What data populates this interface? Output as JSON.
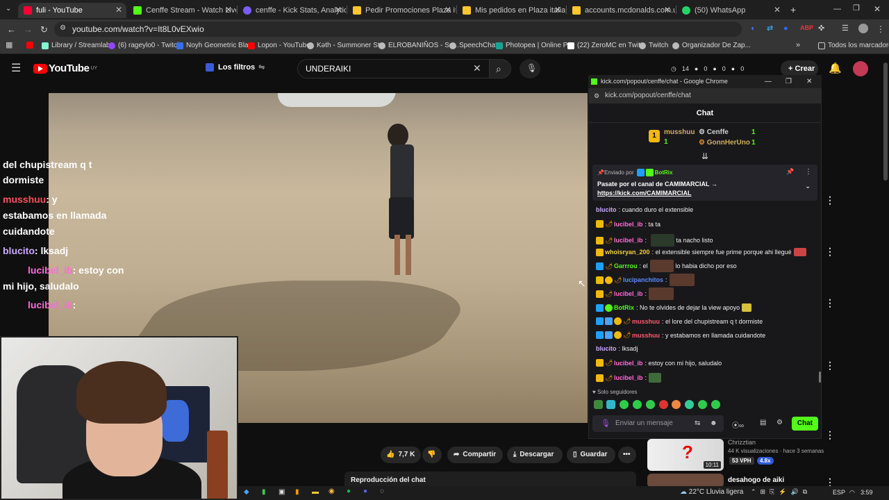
{
  "browser": {
    "tabs": [
      {
        "label": "fuli - YouTube",
        "icon": "youtube-icon",
        "color": "#ff0033"
      },
      {
        "label": "Cenffe Stream - Watch Live on",
        "icon": "kick-icon",
        "color": "#53fc18"
      },
      {
        "label": "cenffe - Kick Stats, Analytics an",
        "icon": "stats-icon",
        "color": "#7a5cff"
      },
      {
        "label": "Pedir Promociones Plaza italia",
        "icon": "mcdonalds-icon",
        "color": "#ffc72c"
      },
      {
        "label": "Mis pedidos en Plaza italia itl |",
        "icon": "mcdonalds-icon",
        "color": "#ffc72c"
      },
      {
        "label": "accounts.mcdonalds.com.uy/fo",
        "icon": "mcdonalds-icon",
        "color": "#ffc72c"
      },
      {
        "label": "(50) WhatsApp",
        "icon": "whatsapp-icon",
        "color": "#25d366"
      }
    ],
    "new_tab": "+",
    "url": "youtube.com/watch?v=It8L0vEXwio",
    "bookmarks": [
      {
        "label": "",
        "color": "#ff0000"
      },
      {
        "label": "Library / Streamlabs",
        "color": "#80f5d2"
      },
      {
        "label": "(6) rageylo0 - Twitch",
        "color": "#9146ff"
      },
      {
        "label": "Noyh Geometric Bla...",
        "color": "#3a6ee8"
      },
      {
        "label": "Lopon - YouTube",
        "color": "#ff0000"
      },
      {
        "label": "Kəth - Summoner St...",
        "color": "#bbbbbb"
      },
      {
        "label": "ELROBANIÑOS - Su...",
        "color": "#bbbbbb"
      },
      {
        "label": "SpeechChat",
        "color": "#bbbbbb"
      },
      {
        "label": "Photopea | Online P...",
        "color": "#18a497"
      },
      {
        "label": "(22) ZeroMC en Twit...",
        "color": "#ffffff"
      },
      {
        "label": "Twitch",
        "color": "#bbbbbb"
      },
      {
        "label": "Organizador De Zap...",
        "color": "#bbbbbb"
      }
    ],
    "all_bookmarks": "Todos los marcadores"
  },
  "youtube": {
    "logo": "YouTube",
    "region": "UY",
    "filters": "Los filtros",
    "search_value": "UNDERAIKI",
    "counters": [
      "14",
      "0",
      "0",
      "0"
    ],
    "create": "Crear",
    "like_count": "7,7 K",
    "share": "Compartir",
    "download": "Descargar",
    "save": "Guardar",
    "chat_replay": "Reproducción del chat",
    "side_video": {
      "channel": "Chrizztian",
      "meta": "44 K visualizaciones · hace 3 semanas",
      "vph": "53 VPH",
      "mult": "4.8x",
      "duration": "10:11",
      "next_title": "desahogo de aiki"
    }
  },
  "overlay_chat": [
    {
      "user": "",
      "text": "del chupistream q t"
    },
    {
      "user": "",
      "text": "dormiste"
    },
    {
      "user": "musshuu",
      "text": ": y"
    },
    {
      "user": "",
      "text": "estabamos en llamada"
    },
    {
      "user": "",
      "text": "cuidandote"
    },
    {
      "user": "blucito",
      "text": ": lksadj"
    },
    {
      "user": "lucibel_ib",
      "text": ": estoy con"
    },
    {
      "user": "",
      "text": "mi hijo, saludalo"
    },
    {
      "user": "lucibel_ib",
      "text": ":"
    }
  ],
  "popup": {
    "window_title": "kick.com/popout/cenffe/chat - Google Chrome",
    "url": "kick.com/popout/cenffe/chat",
    "chat_title": "Chat",
    "leaderboard": [
      {
        "rank": "1",
        "name": "musshuu",
        "count": "1"
      },
      {
        "rank": "",
        "name": "Cenffe",
        "count": "1"
      },
      {
        "rank": "",
        "name": "GonnHerUno",
        "count": "1"
      }
    ],
    "pinned": {
      "by_label": "Enviado por",
      "by_user": "BotRix",
      "text": "Pasate por el canal de CAMIMARCIAL →",
      "link": "https://kick.com/CAMIMARCIAL"
    },
    "messages": [
      {
        "user": "blucito",
        "color": "#cfa8ff",
        "text": "cuando duro el extensible"
      },
      {
        "user": "lucibel_ib",
        "color": "#ff6bd6",
        "text": "ta ta"
      },
      {
        "user": "lucibel_ib",
        "color": "#ff6bd6",
        "text": "ta nacho listo"
      },
      {
        "user": "whoisryan_200",
        "color": "#f4d03f",
        "text": "el extensible siempre fue prime porque ahi llegué"
      },
      {
        "user": "Garrrou",
        "color": "#53fc18",
        "text": "el"
      },
      {
        "user": "lucipanchitos",
        "color": "#5b8cff",
        "text": ""
      },
      {
        "user": "lucibel_ib",
        "color": "#ff6bd6",
        "text": ""
      },
      {
        "user": "BotRix",
        "color": "#53fc18",
        "text": "No te olvides de dejar la view apoyo"
      },
      {
        "user": "musshuu",
        "color": "#ff5a6e",
        "text": "el lore del chupistream q t dormiste"
      },
      {
        "user": "musshuu",
        "color": "#ff5a6e",
        "text": "y estabamos en llamada cuidandote"
      },
      {
        "user": "blucito",
        "color": "#cfa8ff",
        "text": "lksadj"
      },
      {
        "user": "lucibel_ib",
        "color": "#ff6bd6",
        "text": "estoy con mi hijo, saludalo"
      },
      {
        "user": "lucibel_ib",
        "color": "#ff6bd6",
        "text": ""
      }
    ],
    "inline_extra": {
      "garrrou_tail": "lo habia dicho por eso"
    },
    "followers_only": "Solo seguidores",
    "input_placeholder": "Enviar un mensaje",
    "chat_button": "Chat"
  },
  "taskbar": {
    "weather": "22°C Lluvia ligera",
    "lang": "ESP",
    "time": "3:59"
  }
}
